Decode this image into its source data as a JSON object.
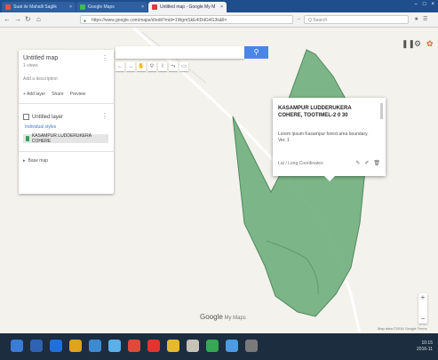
{
  "browser": {
    "tabs": [
      {
        "title": "Suat ile Mahalli Saglik",
        "color": "#e8553e",
        "active": false
      },
      {
        "title": "Google Maps",
        "color": "#3cba54",
        "active": false
      },
      {
        "title": "Untitled map - Google My M",
        "color": "#e03a3a",
        "active": true
      }
    ],
    "url": "https://www.google.com/maps/d/edit?mid=1WgmSkE4IDdG4G3k&ll=",
    "search_placeholder": "Q Search",
    "window_controls": [
      "–",
      "□",
      "×"
    ]
  },
  "panel": {
    "map_title": "Untitled map",
    "views": "1 views",
    "description": "Add a description",
    "actions": [
      "+ Add layer",
      "Share",
      "Preview"
    ],
    "layer_name": "Untitled layer",
    "style_link": "Individual styles",
    "item_label": "KASAMPUR LUDDERUKERA COHERE",
    "basemap_label": "Base map"
  },
  "map_search": {
    "placeholder": "",
    "button_icon": "search-icon"
  },
  "toolbar_icons": [
    "←",
    "→",
    "✋",
    "⚲",
    "⌇",
    "⤳",
    "▭"
  ],
  "popup": {
    "title": "KASAMPUR LUDDERUKERA COHERE, TOOTIMEL-2 0 30",
    "description": "Lorem ipsum Kasampur forest area boundary. Ver. 1",
    "footer": "Lat / Long Coordinates",
    "icons": [
      "brush-icon",
      "pencil-icon",
      "delete-icon"
    ]
  },
  "google_logo": "Google",
  "google_logo_suffix": " My Maps",
  "attribution": "Map data ©2016 Google Terms",
  "taskbar": {
    "time": "10:15",
    "date": "2016-11"
  },
  "colors": {
    "polygon_fill": "#6fae7c",
    "polygon_stroke": "#4f8a5e",
    "accent_blue": "#4a86e8",
    "taskbar": "#1c2d3f"
  },
  "taskbar_icon_colors": [
    "#3a7bd5",
    "#2f62b5",
    "#1f6fdd",
    "#e0a31e",
    "#3d8ad1",
    "#5bb0e8",
    "#e04a3a",
    "#e3342f",
    "#e7b82d",
    "#c7c2b8",
    "#35a853",
    "#4d9be0",
    "#7a7a7a"
  ]
}
